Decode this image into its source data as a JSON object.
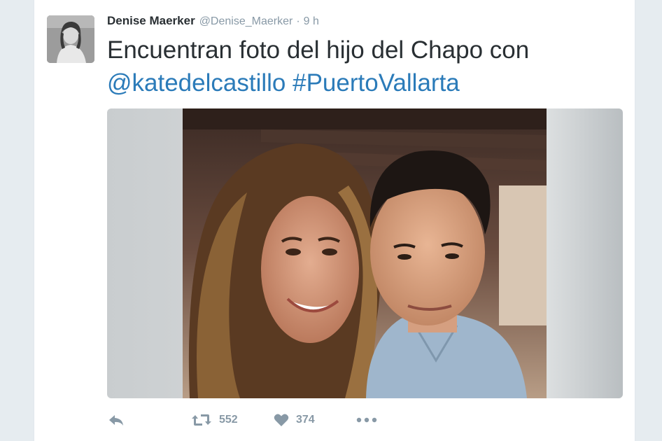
{
  "tweet": {
    "author_name": "Denise Maerker",
    "author_handle": "@Denise_Maerker",
    "separator": "·",
    "timestamp": "9 h",
    "text_plain": "Encuentran foto del hijo del Chapo con",
    "mention": "@katedelcastillo",
    "hashtag": "#PuertoVallarta"
  },
  "actions": {
    "retweet_count": "552",
    "like_count": "374"
  },
  "icons": [
    "reply-icon",
    "retweet-icon",
    "heart-icon",
    "more-icon"
  ],
  "colors": {
    "link": "#2b7bb9",
    "meta_gray": "#8899a6",
    "text": "#292f33",
    "page_bg": "#e6ecf0"
  }
}
